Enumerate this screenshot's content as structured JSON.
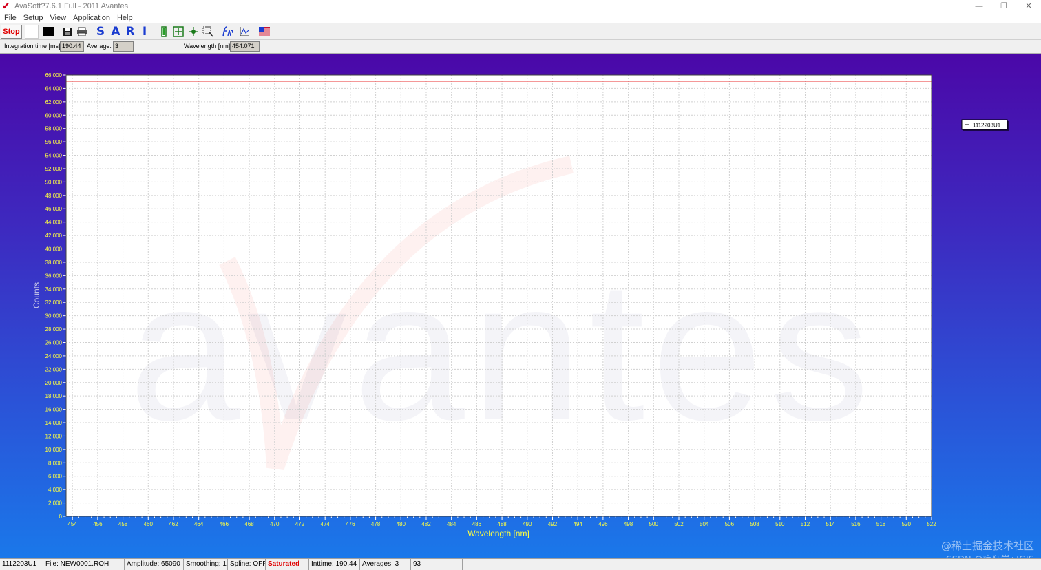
{
  "window": {
    "title": "AvaSoft?7.6.1 Full - 2011 Avantes",
    "app_icon": "avantes-check-icon",
    "minimize": "—",
    "restore": "❐",
    "close": "✕"
  },
  "menu": [
    "File",
    "Setup",
    "View",
    "Application",
    "Help"
  ],
  "toolbar": {
    "stop_label": "Stop",
    "mode_letters": [
      "S",
      "A",
      "R",
      "I"
    ],
    "icons": [
      "save-icon",
      "print-icon",
      "battery-icon",
      "zoom-fit-icon",
      "zoom-move-icon",
      "zoom-select-icon",
      "function-icon",
      "chart-icon",
      "flag-icon"
    ]
  },
  "params": {
    "integration_label": "Integration time [ms]:",
    "integration_value": "190.44",
    "average_label": "Average:",
    "average_value": "3",
    "wavelength_label": "Wavelength [nm]:",
    "wavelength_value": "454.071"
  },
  "chart_data": {
    "type": "line",
    "ylabel": "Counts",
    "xlabel": "Wavelength [nm]",
    "xlim": [
      453.5,
      522
    ],
    "ylim": [
      0,
      66000
    ],
    "x_ticks": [
      454,
      456,
      458,
      460,
      462,
      464,
      466,
      468,
      470,
      472,
      474,
      476,
      478,
      480,
      482,
      484,
      486,
      488,
      490,
      492,
      494,
      496,
      498,
      500,
      502,
      504,
      506,
      508,
      510,
      512,
      514,
      516,
      518,
      520,
      522
    ],
    "y_ticks": [
      0,
      2000,
      4000,
      6000,
      8000,
      10000,
      12000,
      14000,
      16000,
      18000,
      20000,
      22000,
      24000,
      26000,
      28000,
      30000,
      32000,
      34000,
      36000,
      38000,
      40000,
      42000,
      44000,
      46000,
      48000,
      50000,
      52000,
      54000,
      56000,
      58000,
      60000,
      62000,
      64000,
      66000
    ],
    "grid": true,
    "legend_position": "top-right",
    "series": [
      {
        "name": "1112203U1",
        "color": "#e83030",
        "x": [
          453.5,
          522
        ],
        "y": [
          65090,
          65090
        ]
      }
    ],
    "watermark": "avantes"
  },
  "status": {
    "spectrometer": "1112203U1",
    "file": "File: NEW0001.ROH",
    "amplitude": "Amplitude: 65090",
    "smoothing": "Smoothing: 1",
    "spline": "Spline: OFF",
    "saturated": "Saturated",
    "inttime": "Inttime: 190.44",
    "averages": "Averages: 3",
    "extra": "93"
  },
  "overlay_watermark": {
    "line1": "@稀土掘金技术社区",
    "line2": "CSDN @疯狂学习GIS"
  }
}
